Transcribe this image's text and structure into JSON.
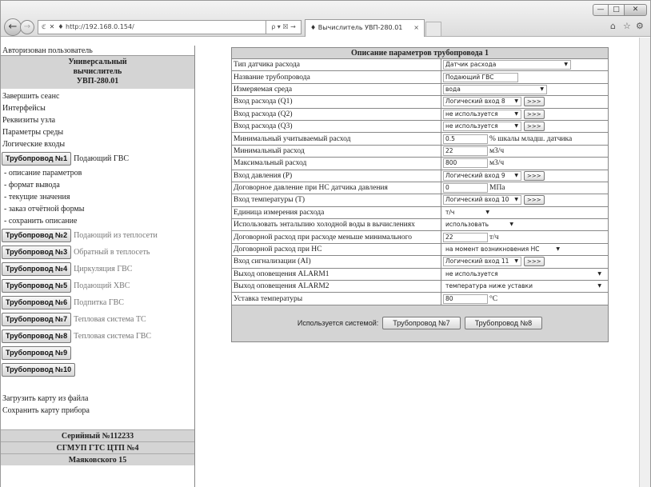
{
  "browser": {
    "url": "http://192.168.0.154/",
    "search_symbols": "ρ ▾ ☒ →",
    "tab_title": "Вычислитель УВП-280.01",
    "tab_close": "×"
  },
  "sidebar": {
    "user": "Авторизован пользователь",
    "title_lines": [
      "Универсальный",
      "вычислитель",
      "УВП-280.01"
    ],
    "links": [
      "Завершить сеанс",
      "Интерфейсы",
      "Реквизиты узла",
      "Параметры среды",
      "Логические входы"
    ],
    "pipelines": [
      {
        "label": "Трубопровод №1",
        "name": "Подающий ГВС",
        "active": true
      },
      {
        "label": "Трубопровод №2",
        "name": "Подающий из теплосети"
      },
      {
        "label": "Трубопровод №3",
        "name": "Обратный в теплосеть"
      },
      {
        "label": "Трубопровод №4",
        "name": "Циркуляция ГВС"
      },
      {
        "label": "Трубопровод №5",
        "name": "Подающий ХВС"
      },
      {
        "label": "Трубопровод №6",
        "name": "Подпитка ГВС"
      },
      {
        "label": "Трубопровод №7",
        "name": "Тепловая система ТС"
      },
      {
        "label": "Трубопровод №8",
        "name": "Тепловая система ГВС"
      },
      {
        "label": "Трубопровод №9",
        "name": ""
      },
      {
        "label": "Трубопровод №10",
        "name": ""
      }
    ],
    "sub_items": [
      "- описание параметров",
      "- формат вывода",
      "- текущие значения",
      "- заказ отчётной формы",
      "- сохранить описание"
    ],
    "bottom_links": [
      "Загрузить карту из файла",
      "Сохранить карту прибора"
    ],
    "footer": [
      "Серийный №112233",
      "СГМУП ГТС ЦТП №4",
      "Маяковского 15"
    ]
  },
  "form": {
    "header": "Описание параметров трубопровода 1",
    "rows": {
      "sensor_type": {
        "label": "Тип датчика расхода",
        "value": "Датчик расхода"
      },
      "pipe_name": {
        "label": "Название трубопровода",
        "value": "Подающий ГВС"
      },
      "medium": {
        "label": "Измеряемая среда",
        "value": "вода"
      },
      "q1": {
        "label": "Вход расхода (Q1)",
        "value": "Логический вход 8",
        "btn": ">>>"
      },
      "q2": {
        "label": "Вход расхода (Q2)",
        "value": "не используется",
        "btn": ">>>"
      },
      "q3": {
        "label": "Вход расхода (Q3)",
        "value": "не используется",
        "btn": ">>>"
      },
      "min_account": {
        "label": "Минимальный учитываемый расход",
        "value": "0.5",
        "unit": "% шкалы младш. датчика"
      },
      "min_flow": {
        "label": "Минимальный расход",
        "value": "22",
        "unit": "м3/ч"
      },
      "max_flow": {
        "label": "Максимальный расход",
        "value": "800",
        "unit": "м3/ч"
      },
      "pressure": {
        "label": "Вход давления (P)",
        "value": "Логический вход 9",
        "btn": ">>>"
      },
      "contract_pressure": {
        "label": "Договорное давление при НС датчика давления",
        "value": "0",
        "unit": "МПа"
      },
      "temperature": {
        "label": "Вход температуры (T)",
        "value": "Логический вход 10",
        "btn": ">>>"
      },
      "flow_unit": {
        "label": "Единица измерения расхода",
        "value": "т/ч"
      },
      "enthalpy": {
        "label": "Использовать энтальпию холодной воды в вычислениях",
        "value": "использовать"
      },
      "contract_flow_low": {
        "label": "Договорной расход при расходе меньше минимального",
        "value": "22",
        "unit": "т/ч"
      },
      "contract_flow_ns": {
        "label": "Договорной расход при НС",
        "value": "на момент возникновения НС"
      },
      "alarm_input": {
        "label": "Вход сигнализации (AI)",
        "value": "Логический вход 11",
        "btn": ">>>"
      },
      "alarm1": {
        "label": "Выход оповещения ALARM1",
        "value": "не используется"
      },
      "alarm2": {
        "label": "Выход оповещения ALARM2",
        "value": "температура ниже уставки"
      },
      "temp_setpoint": {
        "label": "Уставка температуры",
        "value": "80",
        "unit": "°С"
      }
    },
    "used_by_label": "Используется системой:",
    "used_by": [
      "Трубопровод №7",
      "Трубопровод №8"
    ]
  }
}
